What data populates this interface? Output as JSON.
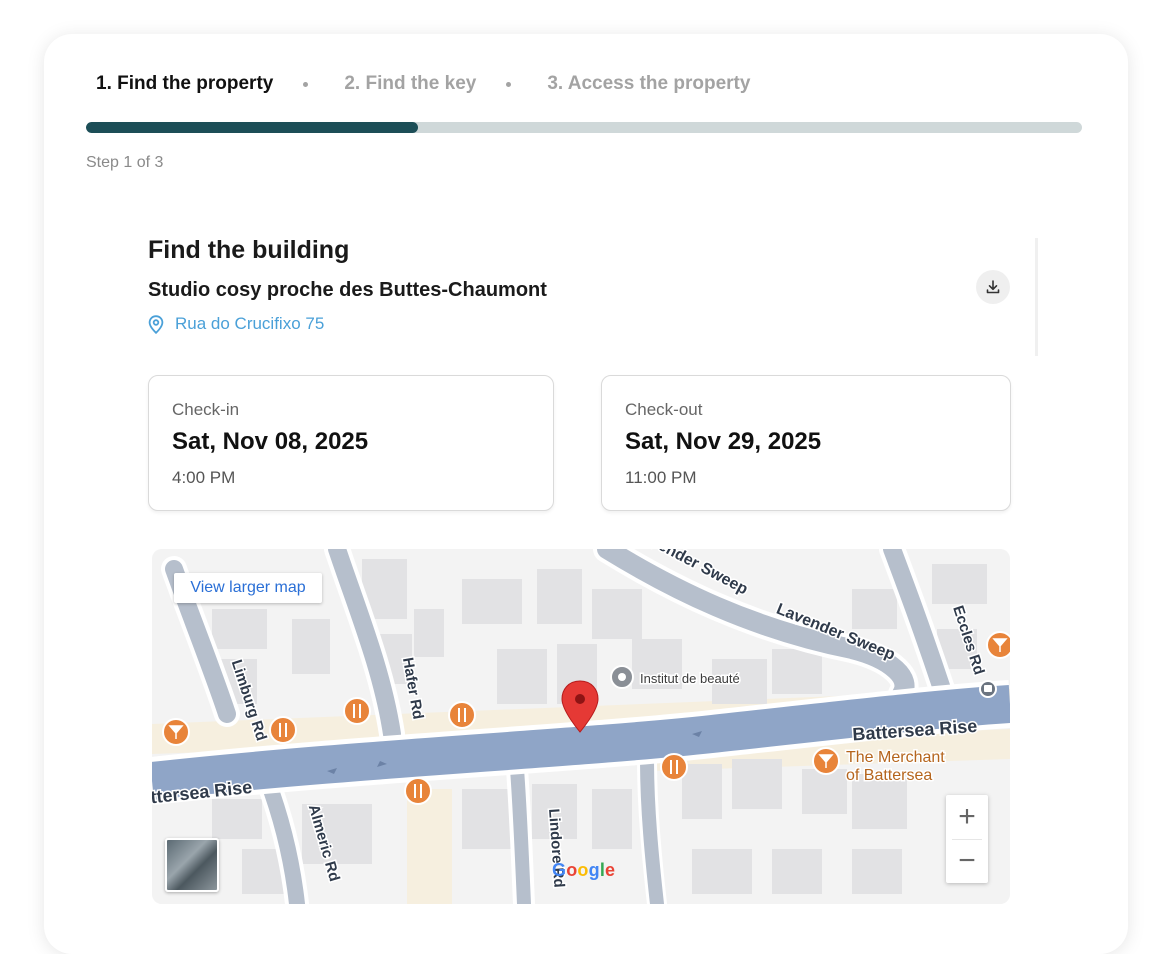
{
  "stepper": {
    "steps": [
      "1. Find the property",
      "2. Find the key",
      "3. Access the property"
    ],
    "current_step": 1,
    "total_steps": 3,
    "progress_fraction": 0.333,
    "counter": "Step 1 of 3"
  },
  "building": {
    "title": "Find the building",
    "property_name": "Studio cosy proche des Buttes-Chaumont",
    "address": "Rua do Crucifixo 75"
  },
  "checkin": {
    "label": "Check-in",
    "date": "Sat, Nov 08, 2025",
    "time": "4:00 PM"
  },
  "checkout": {
    "label": "Check-out",
    "date": "Sat, Nov 29, 2025",
    "time": "11:00 PM"
  },
  "map": {
    "view_larger": "View larger map",
    "zoom_in": "+",
    "zoom_out": "−",
    "provider": "Google",
    "streets": {
      "battersea_main": "Battersea Rise",
      "battersea_left": "ttersea Rise",
      "lavender_top": "Lavender Sweep",
      "lavender_mid": "Lavender Sweep",
      "eccles": "Eccles Rd",
      "limburg": "Limburg Rd",
      "hafer": "Hafer Rd",
      "almeric": "Almeric Rd",
      "lindore": "Lindore Rd"
    },
    "pois": {
      "institut": "Institut de beauté",
      "merchant_line1": "The Merchant",
      "merchant_line2": "of Battersea"
    },
    "icons": [
      "restaurant-icon",
      "bar-icon",
      "bus-stop-icon",
      "location-pin-icon"
    ]
  },
  "colors": {
    "progress_fill": "#1c4e57",
    "progress_track": "#cfd8d9",
    "address_link": "#4aa0d8",
    "map_pin": "#e53935",
    "poi_orange": "#e8843a",
    "road_major": "#8fa5c7"
  }
}
